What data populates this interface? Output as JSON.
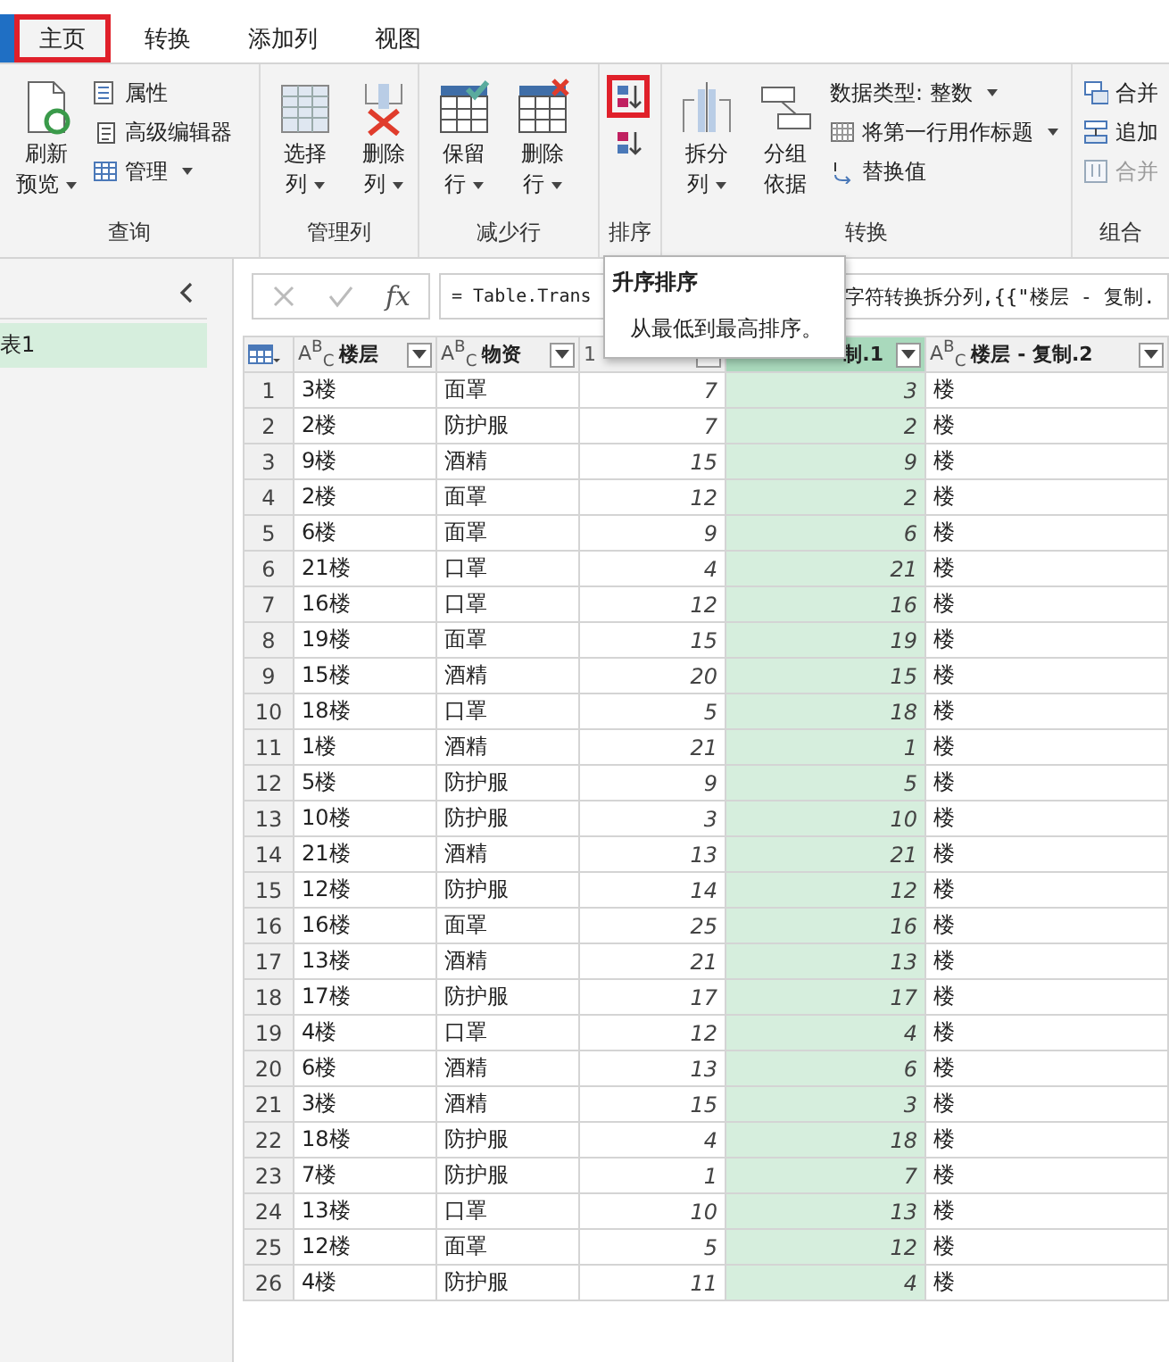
{
  "tabs": [
    {
      "label": "主页",
      "selected": true,
      "highlighted": true
    },
    {
      "label": "转换",
      "selected": false,
      "highlighted": false
    },
    {
      "label": "添加列",
      "selected": false,
      "highlighted": false
    },
    {
      "label": "视图",
      "selected": false,
      "highlighted": false
    }
  ],
  "ribbon": {
    "groups": [
      {
        "label": "查询",
        "items": [
          {
            "kind": "large",
            "lines": [
              "刷新",
              "预览"
            ],
            "dropdown": true
          },
          {
            "kind": "small",
            "label": "属性",
            "dropdown": false
          },
          {
            "kind": "small",
            "label": "高级编辑器",
            "dropdown": false
          },
          {
            "kind": "small",
            "label": "管理",
            "dropdown": true
          }
        ]
      },
      {
        "label": "管理列",
        "items": [
          {
            "kind": "large",
            "lines": [
              "选择",
              "列"
            ],
            "dropdown": true
          },
          {
            "kind": "large",
            "lines": [
              "删除",
              "列"
            ],
            "dropdown": true
          }
        ]
      },
      {
        "label": "减少行",
        "items": [
          {
            "kind": "large",
            "lines": [
              "保留",
              "行"
            ],
            "dropdown": true
          },
          {
            "kind": "large",
            "lines": [
              "删除",
              "行"
            ],
            "dropdown": true
          }
        ]
      },
      {
        "label": "排序",
        "items": [
          {
            "kind": "icon",
            "highlighted": true
          },
          {
            "kind": "icon",
            "highlighted": false
          }
        ]
      },
      {
        "label": "转换",
        "items": [
          {
            "kind": "large",
            "lines": [
              "拆分",
              "列"
            ],
            "dropdown": true
          },
          {
            "kind": "large",
            "lines": [
              "分组",
              "依据"
            ],
            "dropdown": false
          },
          {
            "kind": "small",
            "label": "数据类型: 整数",
            "dropdown": true
          },
          {
            "kind": "small",
            "label": "将第一行用作标题",
            "dropdown": true
          },
          {
            "kind": "small",
            "label": "替换值",
            "dropdown": false
          }
        ]
      },
      {
        "label": "组合",
        "items": [
          {
            "kind": "small",
            "label": "合并",
            "dropdown": false,
            "disabled": false
          },
          {
            "kind": "small",
            "label": "追加",
            "dropdown": false,
            "disabled": false
          },
          {
            "kind": "small",
            "label": "合并",
            "dropdown": false,
            "disabled": true
          }
        ]
      }
    ]
  },
  "queries": [
    {
      "label": "表1",
      "selected": true
    }
  ],
  "formula_bar": {
    "fx": "fx",
    "formula_start": "= Table.Trans",
    "formula_end": "字符转换拆分列,{{\"楼层 - 复制."
  },
  "tooltip": {
    "title": "升序排序",
    "description": "从最低到最高排序。"
  },
  "table": {
    "columns": [
      {
        "type_label": "A$^{B}$$_{C}$",
        "name": "楼层",
        "selected": false,
        "kind": "text"
      },
      {
        "type_label": "A$^{B}$$_{C}$",
        "name": "物资",
        "selected": false,
        "kind": "text"
      },
      {
        "type_label": "1",
        "selected": false,
        "kind": "number"
      },
      {
        "name": "制.1",
        "selected": true,
        "kind": "number"
      },
      {
        "type_label": "A$^{B}$$_{C}$",
        "name": "楼层 - 复制.2",
        "selected": false,
        "kind": "text"
      }
    ],
    "rows": [
      {
        "number": "1",
        "cells": [
          "3楼",
          "面罩",
          "7",
          "3",
          "楼"
        ]
      },
      {
        "number": "2",
        "cells": [
          "2楼",
          "防护服",
          "7",
          "2",
          "楼"
        ]
      },
      {
        "number": "3",
        "cells": [
          "9楼",
          "酒精",
          "15",
          "9",
          "楼"
        ]
      },
      {
        "number": "4",
        "cells": [
          "2楼",
          "面罩",
          "12",
          "2",
          "楼"
        ]
      },
      {
        "number": "5",
        "cells": [
          "6楼",
          "面罩",
          "9",
          "6",
          "楼"
        ]
      },
      {
        "number": "6",
        "cells": [
          "21楼",
          "口罩",
          "4",
          "21",
          "楼"
        ]
      },
      {
        "number": "7",
        "cells": [
          "16楼",
          "口罩",
          "12",
          "16",
          "楼"
        ]
      },
      {
        "number": "8",
        "cells": [
          "19楼",
          "面罩",
          "15",
          "19",
          "楼"
        ]
      },
      {
        "number": "9",
        "cells": [
          "15楼",
          "酒精",
          "20",
          "15",
          "楼"
        ]
      },
      {
        "number": "10",
        "cells": [
          "18楼",
          "口罩",
          "5",
          "18",
          "楼"
        ]
      },
      {
        "number": "11",
        "cells": [
          "1楼",
          "酒精",
          "21",
          "1",
          "楼"
        ]
      },
      {
        "number": "12",
        "cells": [
          "5楼",
          "防护服",
          "9",
          "5",
          "楼"
        ]
      },
      {
        "number": "13",
        "cells": [
          "10楼",
          "防护服",
          "3",
          "10",
          "楼"
        ]
      },
      {
        "number": "14",
        "cells": [
          "21楼",
          "酒精",
          "13",
          "21",
          "楼"
        ]
      },
      {
        "number": "15",
        "cells": [
          "12楼",
          "防护服",
          "14",
          "12",
          "楼"
        ]
      },
      {
        "number": "16",
        "cells": [
          "16楼",
          "面罩",
          "25",
          "16",
          "楼"
        ]
      },
      {
        "number": "17",
        "cells": [
          "13楼",
          "酒精",
          "21",
          "13",
          "楼"
        ]
      },
      {
        "number": "18",
        "cells": [
          "17楼",
          "防护服",
          "17",
          "17",
          "楼"
        ]
      },
      {
        "number": "19",
        "cells": [
          "4楼",
          "口罩",
          "12",
          "4",
          "楼"
        ]
      },
      {
        "number": "20",
        "cells": [
          "6楼",
          "酒精",
          "13",
          "6",
          "楼"
        ]
      },
      {
        "number": "21",
        "cells": [
          "3楼",
          "酒精",
          "15",
          "3",
          "楼"
        ]
      },
      {
        "number": "22",
        "cells": [
          "18楼",
          "防护服",
          "4",
          "18",
          "楼"
        ]
      },
      {
        "number": "23",
        "cells": [
          "7楼",
          "防护服",
          "1",
          "7",
          "楼"
        ]
      },
      {
        "number": "24",
        "cells": [
          "13楼",
          "口罩",
          "10",
          "13",
          "楼"
        ]
      },
      {
        "number": "25",
        "cells": [
          "12楼",
          "面罩",
          "5",
          "12",
          "楼"
        ]
      },
      {
        "number": "26",
        "cells": [
          "4楼",
          "防护服",
          "11",
          "4",
          "楼"
        ]
      }
    ]
  }
}
